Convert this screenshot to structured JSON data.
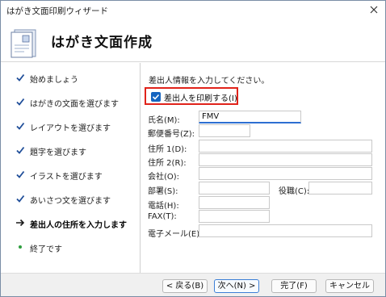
{
  "window": {
    "title": "はがき文面印刷ウィザード"
  },
  "header": {
    "title": "はがき文面作成"
  },
  "steps": [
    {
      "label": "始めましょう",
      "state": "done"
    },
    {
      "label": "はがきの文面を選びます",
      "state": "done"
    },
    {
      "label": "レイアウトを選びます",
      "state": "done"
    },
    {
      "label": "題字を選びます",
      "state": "done"
    },
    {
      "label": "イラストを選びます",
      "state": "done"
    },
    {
      "label": "あいさつ文を選びます",
      "state": "done"
    },
    {
      "label": "差出人の住所を入力します",
      "state": "current"
    },
    {
      "label": "終了です",
      "state": "pending"
    }
  ],
  "form": {
    "intro": "差出人情報を入力してください。",
    "print_sender_label": "差出人を印刷する(I)",
    "print_sender_checked": true,
    "name_label": "氏名(M):",
    "name_value": "FMV",
    "postal_label": "郵便番号(Z):",
    "postal_value": "",
    "address1_label": "住所 1(D):",
    "address1_value": "",
    "address2_label": "住所 2(R):",
    "address2_value": "",
    "company_label": "会社(O):",
    "company_value": "",
    "department_label": "部署(S):",
    "department_value": "",
    "title_label": "役職(C):",
    "title_value": "",
    "phone_label": "電話(H):",
    "phone_value": "",
    "fax_label": "FAX(T):",
    "fax_value": "",
    "email_label": "電子メール(E):",
    "email_value": ""
  },
  "footer": {
    "back_label": "< 戻る(B)",
    "next_label": "次へ(N) >",
    "finish_label": "完了(F)",
    "cancel_label": "キャンセル"
  },
  "colors": {
    "accent": "#1565c0",
    "highlight_border": "#e0231a",
    "step_check": "#1f4e99",
    "step_pending_dot": "#2e9e3e"
  }
}
